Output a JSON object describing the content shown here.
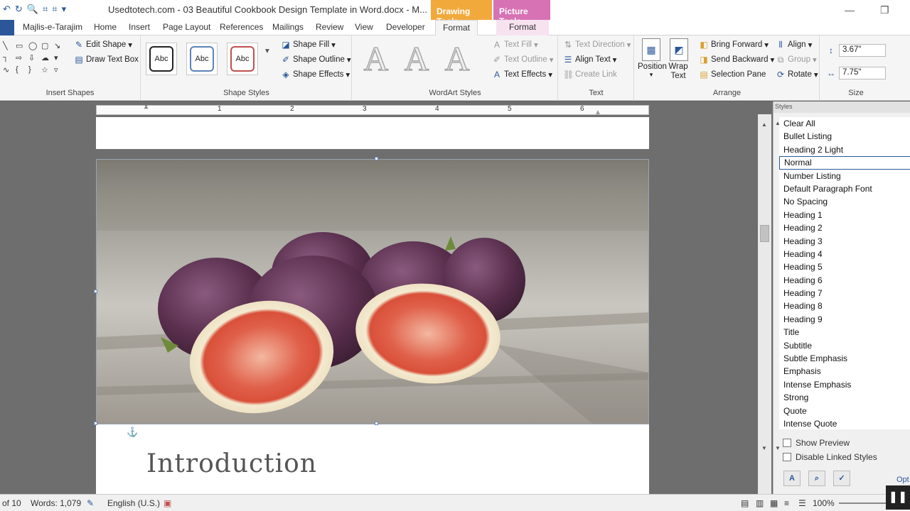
{
  "titlebar": {
    "doc_title": "Usedtotech.com - 03 Beautiful Cookbook Design Template in Word.docx - M...",
    "context_drawing": "Drawing Tools",
    "context_picture": "Picture Tools",
    "minimize": "—",
    "restore": "❐"
  },
  "tabs": {
    "items": [
      "Majlis-e-Tarajim",
      "Home",
      "Insert",
      "Page Layout",
      "References",
      "Mailings",
      "Review",
      "View",
      "Developer"
    ],
    "format_drawing": "Format",
    "format_picture": "Format"
  },
  "ribbon": {
    "insert_shapes": {
      "label": "Insert Shapes",
      "edit_shape": "Edit Shape",
      "draw_text_box": "Draw Text Box"
    },
    "shape_styles": {
      "label": "Shape Styles",
      "samples": [
        "Abc",
        "Abc",
        "Abc"
      ],
      "shape_fill": "Shape Fill",
      "shape_outline": "Shape Outline",
      "shape_effects": "Shape Effects"
    },
    "wordart_styles": {
      "label": "WordArt Styles",
      "glyph": "A",
      "text_fill": "Text Fill",
      "text_outline": "Text Outline",
      "text_effects": "Text Effects"
    },
    "text": {
      "label": "Text",
      "text_direction": "Text Direction",
      "align_text": "Align Text",
      "create_link": "Create Link"
    },
    "arrange": {
      "label": "Arrange",
      "position": "Position",
      "wrap_text": "Wrap Text",
      "bring_forward": "Bring Forward",
      "send_backward": "Send Backward",
      "selection_pane": "Selection Pane",
      "align": "Align",
      "group": "Group",
      "rotate": "Rotate"
    },
    "size": {
      "label": "Size",
      "height": "3.67\"",
      "width": "7.75\""
    }
  },
  "ruler": {
    "numbers": [
      "1",
      "2",
      "3",
      "4",
      "5",
      "6"
    ]
  },
  "document": {
    "heading": "Introduction"
  },
  "styles_pane": {
    "title": "Styles",
    "items": [
      "Clear All",
      "Bullet Listing",
      "Heading 2 Light",
      "Normal",
      "Number Listing",
      "Default Paragraph Font",
      "No Spacing",
      "Heading 1",
      "Heading 2",
      "Heading 3",
      "Heading 4",
      "Heading 5",
      "Heading 6",
      "Heading 7",
      "Heading 8",
      "Heading 9",
      "Title",
      "Subtitle",
      "Subtle Emphasis",
      "Emphasis",
      "Intense Emphasis",
      "Strong",
      "Quote",
      "Intense Quote"
    ],
    "selected": "Normal",
    "show_preview": "Show Preview",
    "disable_linked": "Disable Linked Styles",
    "options": "Opt"
  },
  "statusbar": {
    "page": "of 10",
    "words": "Words: 1,079",
    "language": "English (U.S.)",
    "zoom": "100%"
  },
  "colors": {
    "accent": "#2b579a",
    "drawing_tools": "#f2a93b",
    "picture_tools": "#d772b5"
  }
}
